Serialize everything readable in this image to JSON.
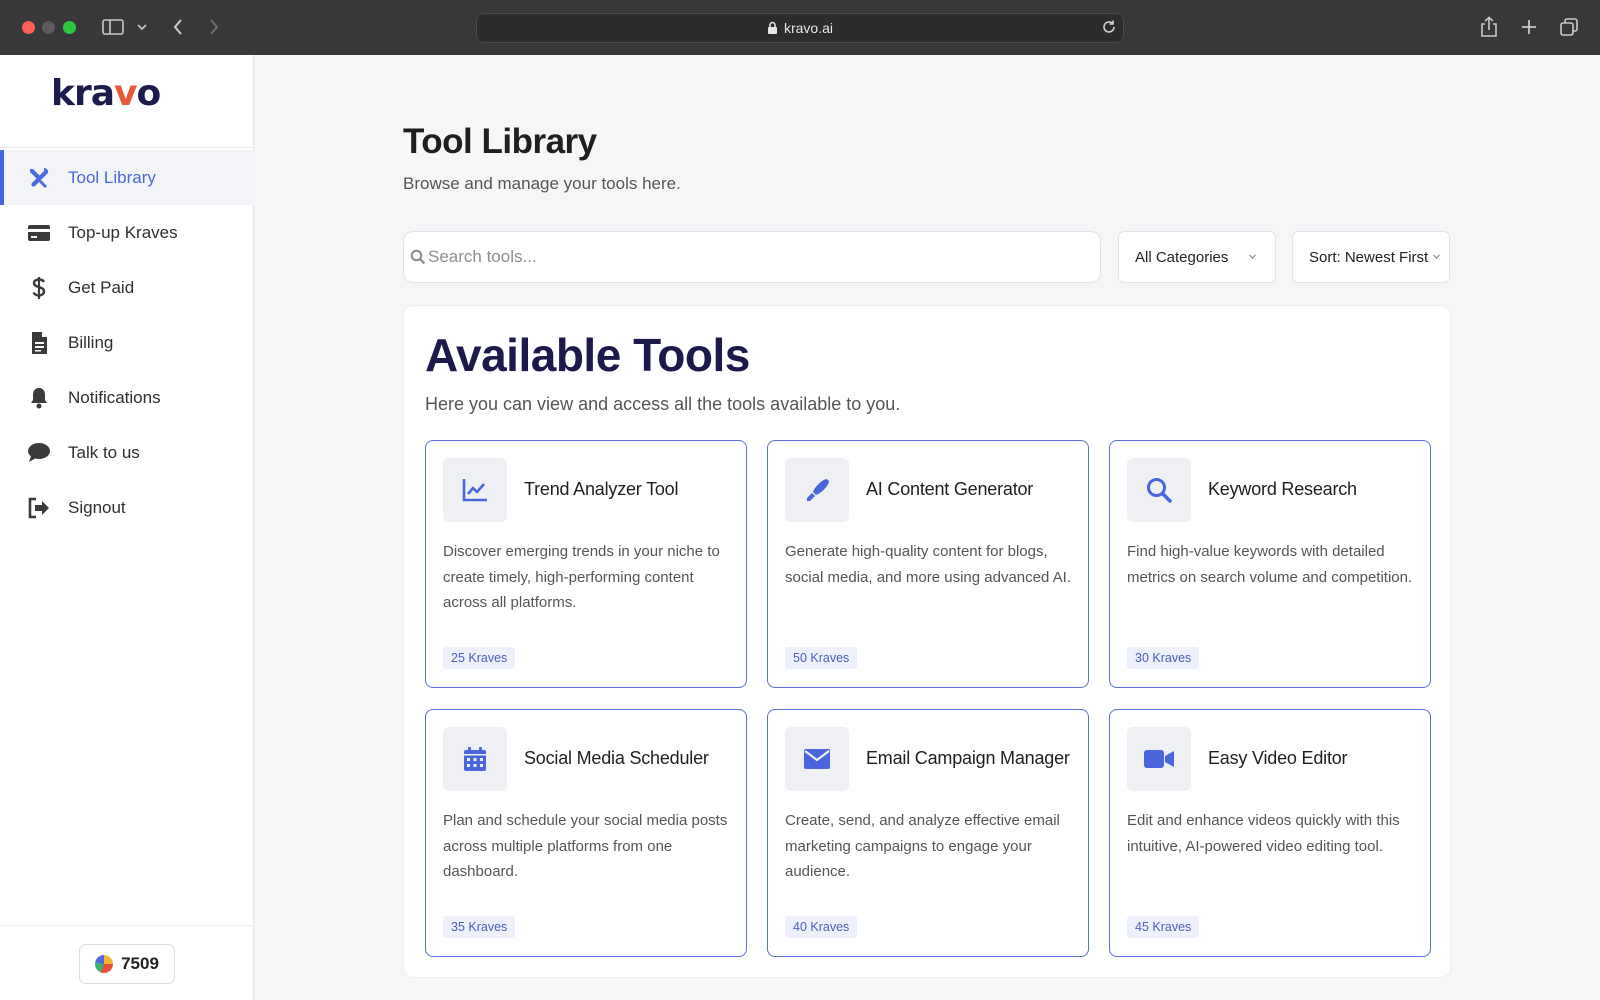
{
  "browser": {
    "url": "kravo.ai"
  },
  "sidebar": {
    "logo": {
      "pre": "kra",
      "accent": "v",
      "post": "o"
    },
    "items": [
      {
        "label": "Tool Library",
        "icon": "tools-icon",
        "active": true
      },
      {
        "label": "Top-up Kraves",
        "icon": "credit-card-icon",
        "active": false
      },
      {
        "label": "Get Paid",
        "icon": "dollar-icon",
        "active": false
      },
      {
        "label": "Billing",
        "icon": "invoice-icon",
        "active": false
      },
      {
        "label": "Notifications",
        "icon": "bell-icon",
        "active": false
      },
      {
        "label": "Talk to us",
        "icon": "chat-bubble-icon",
        "active": false
      },
      {
        "label": "Signout",
        "icon": "signout-icon",
        "active": false
      }
    ],
    "kraves_balance": "7509"
  },
  "header": {
    "title": "Tool Library",
    "subtitle": "Browse and manage your tools here."
  },
  "filters": {
    "search_placeholder": "Search tools...",
    "search_value": "",
    "category": "All Categories",
    "sort": "Sort: Newest First"
  },
  "panel": {
    "title": "Available Tools",
    "subtitle": "Here you can view and access all the tools available to you."
  },
  "tools": [
    {
      "name": "Trend Analyzer Tool",
      "icon": "line-chart-icon",
      "description": "Discover emerging trends in your niche to create timely, high-performing content across all platforms.",
      "cost": "25 Kraves"
    },
    {
      "name": "AI Content Generator",
      "icon": "pen-icon",
      "description": "Generate high-quality content for blogs, social media, and more using advanced AI.",
      "cost": "50 Kraves"
    },
    {
      "name": "Keyword Research",
      "icon": "magnifier-icon",
      "description": "Find high-value keywords with detailed metrics on search volume and competition.",
      "cost": "30 Kraves"
    },
    {
      "name": "Social Media Scheduler",
      "icon": "calendar-icon",
      "description": "Plan and schedule your social media posts across multiple platforms from one dashboard.",
      "cost": "35 Kraves"
    },
    {
      "name": "Email Campaign Manager",
      "icon": "envelope-icon",
      "description": "Create, send, and analyze effective email marketing campaigns to engage your audience.",
      "cost": "40 Kraves"
    },
    {
      "name": "Easy Video Editor",
      "icon": "video-camera-icon",
      "description": "Edit and enhance videos quickly with this intuitive, AI-powered video editing tool.",
      "cost": "45 Kraves"
    }
  ],
  "colors": {
    "accent": "#4a66dd",
    "brand_dark": "#1b1a4a",
    "brand_orange": "#e55a3a"
  }
}
